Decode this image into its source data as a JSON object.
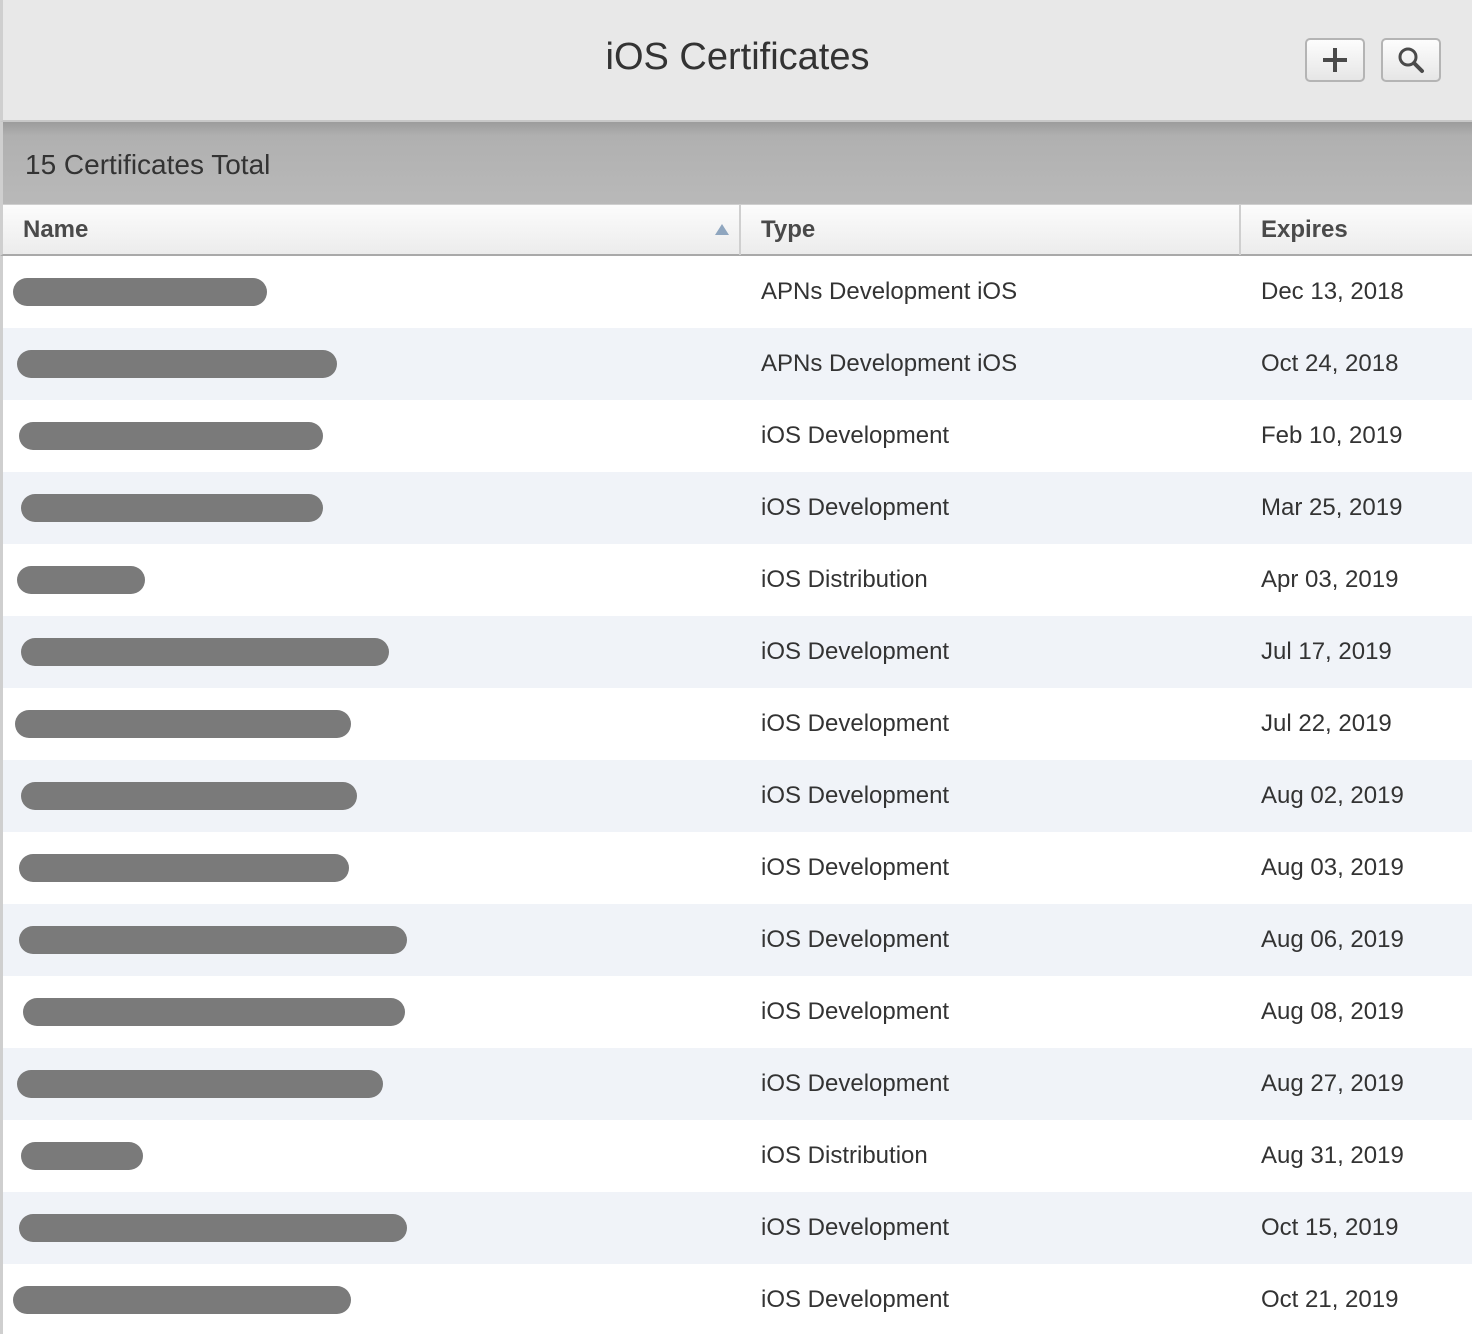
{
  "header": {
    "title": "iOS Certificates",
    "add_icon": "plus-icon",
    "search_icon": "search-icon"
  },
  "summary": {
    "text": "15 Certificates Total"
  },
  "columns": {
    "name": "Name",
    "type": "Type",
    "expires": "Expires",
    "sort_icon": "sort-ascending-icon"
  },
  "colors": {
    "header_bg": "#e8e8e8",
    "summary_bg": "#b9b9b9",
    "row_alt_bg": "#f0f3f8",
    "redaction": "#7a7a7a",
    "sort_arrow": "#8fa6bf"
  },
  "rows": [
    {
      "type": "APNs Development iOS",
      "expires": "Dec 13, 2018"
    },
    {
      "type": "APNs Development iOS",
      "expires": "Oct 24, 2018"
    },
    {
      "type": "iOS Development",
      "expires": "Feb 10, 2019"
    },
    {
      "type": "iOS Development",
      "expires": "Mar 25, 2019"
    },
    {
      "type": "iOS Distribution",
      "expires": "Apr 03, 2019"
    },
    {
      "type": "iOS Development",
      "expires": "Jul 17, 2019"
    },
    {
      "type": "iOS Development",
      "expires": "Jul 22, 2019"
    },
    {
      "type": "iOS Development",
      "expires": "Aug 02, 2019"
    },
    {
      "type": "iOS Development",
      "expires": "Aug 03, 2019"
    },
    {
      "type": "iOS Development",
      "expires": "Aug 06, 2019"
    },
    {
      "type": "iOS Development",
      "expires": "Aug 08, 2019"
    },
    {
      "type": "iOS Development",
      "expires": "Aug 27, 2019"
    },
    {
      "type": "iOS Distribution",
      "expires": "Aug 31, 2019"
    },
    {
      "type": "iOS Development",
      "expires": "Oct 15, 2019"
    },
    {
      "type": "iOS Development",
      "expires": "Oct 21, 2019"
    }
  ]
}
